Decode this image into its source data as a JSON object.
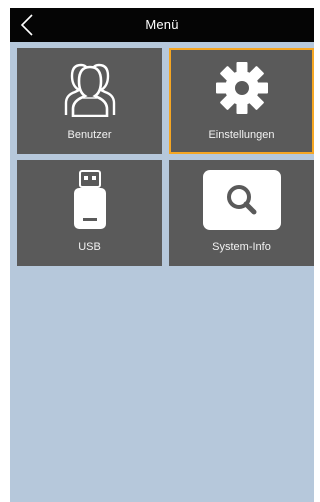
{
  "header": {
    "title": "Menü",
    "back_icon": "chevron-left-icon"
  },
  "tiles": [
    {
      "label": "Benutzer",
      "icon": "users-icon",
      "selected": false
    },
    {
      "label": "Einstellungen",
      "icon": "gear-icon",
      "selected": true
    },
    {
      "label": "USB",
      "icon": "usb-drive-icon",
      "selected": false
    },
    {
      "label": "System-Info",
      "icon": "search-icon",
      "selected": false
    }
  ],
  "colors": {
    "header_bg": "#050505",
    "screen_bg": "#b6c8db",
    "tile_bg": "#5a5a5a",
    "selection": "#f5a623"
  }
}
